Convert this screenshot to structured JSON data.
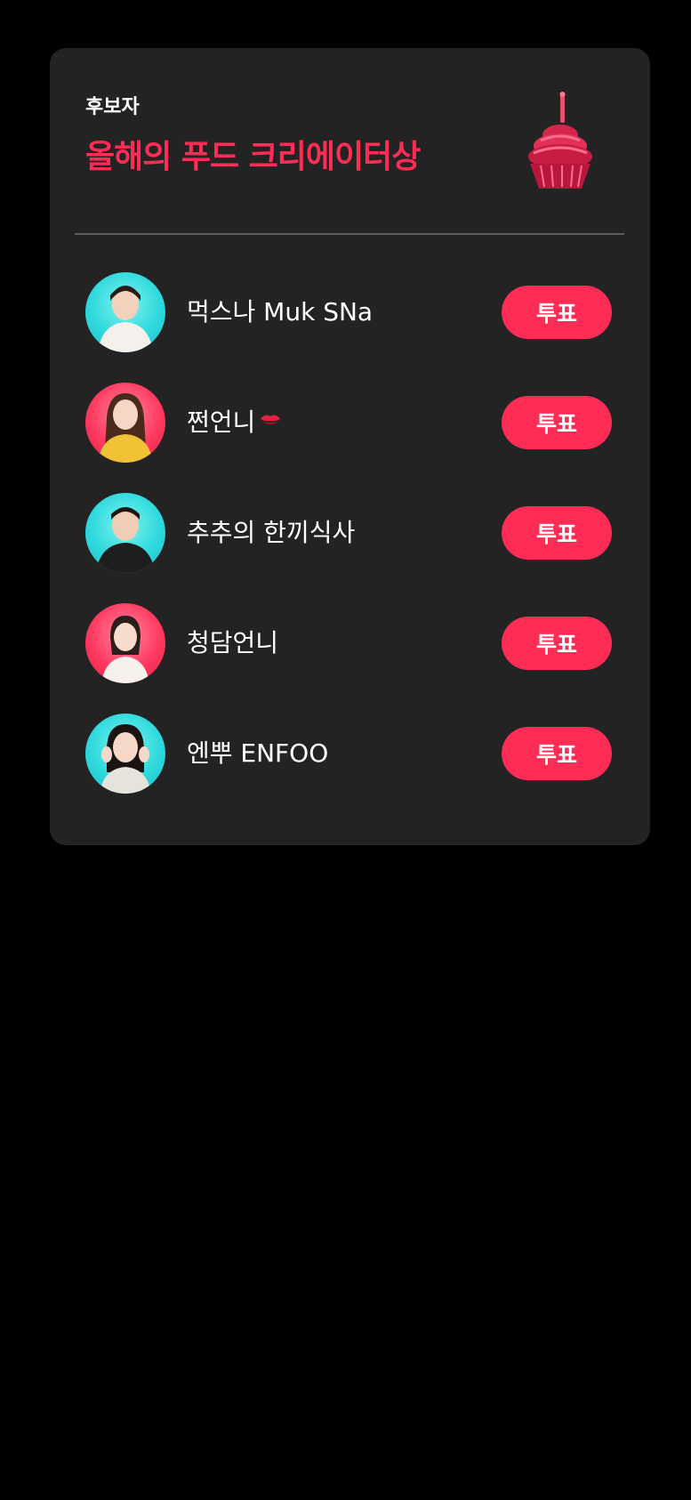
{
  "card": {
    "eyebrow": "후보자",
    "title": "올해의 푸드 크리에이터상",
    "trophy_icon": "cupcake-trophy-icon",
    "accent_color": "#ff2d55"
  },
  "nominees": [
    {
      "name": "먹스나 Muk SNa",
      "avatar_bg": "cyan",
      "vote_label": "투표"
    },
    {
      "name": "쩐언니",
      "emoji": "💋",
      "avatar_bg": "pink",
      "vote_label": "투표"
    },
    {
      "name": "추추의 한끼식사",
      "avatar_bg": "cyan",
      "vote_label": "투표"
    },
    {
      "name": "청담언니",
      "avatar_bg": "pink",
      "vote_label": "투표"
    },
    {
      "name": "엔뿌 ENFOO",
      "avatar_bg": "cyan",
      "vote_label": "투표"
    }
  ]
}
